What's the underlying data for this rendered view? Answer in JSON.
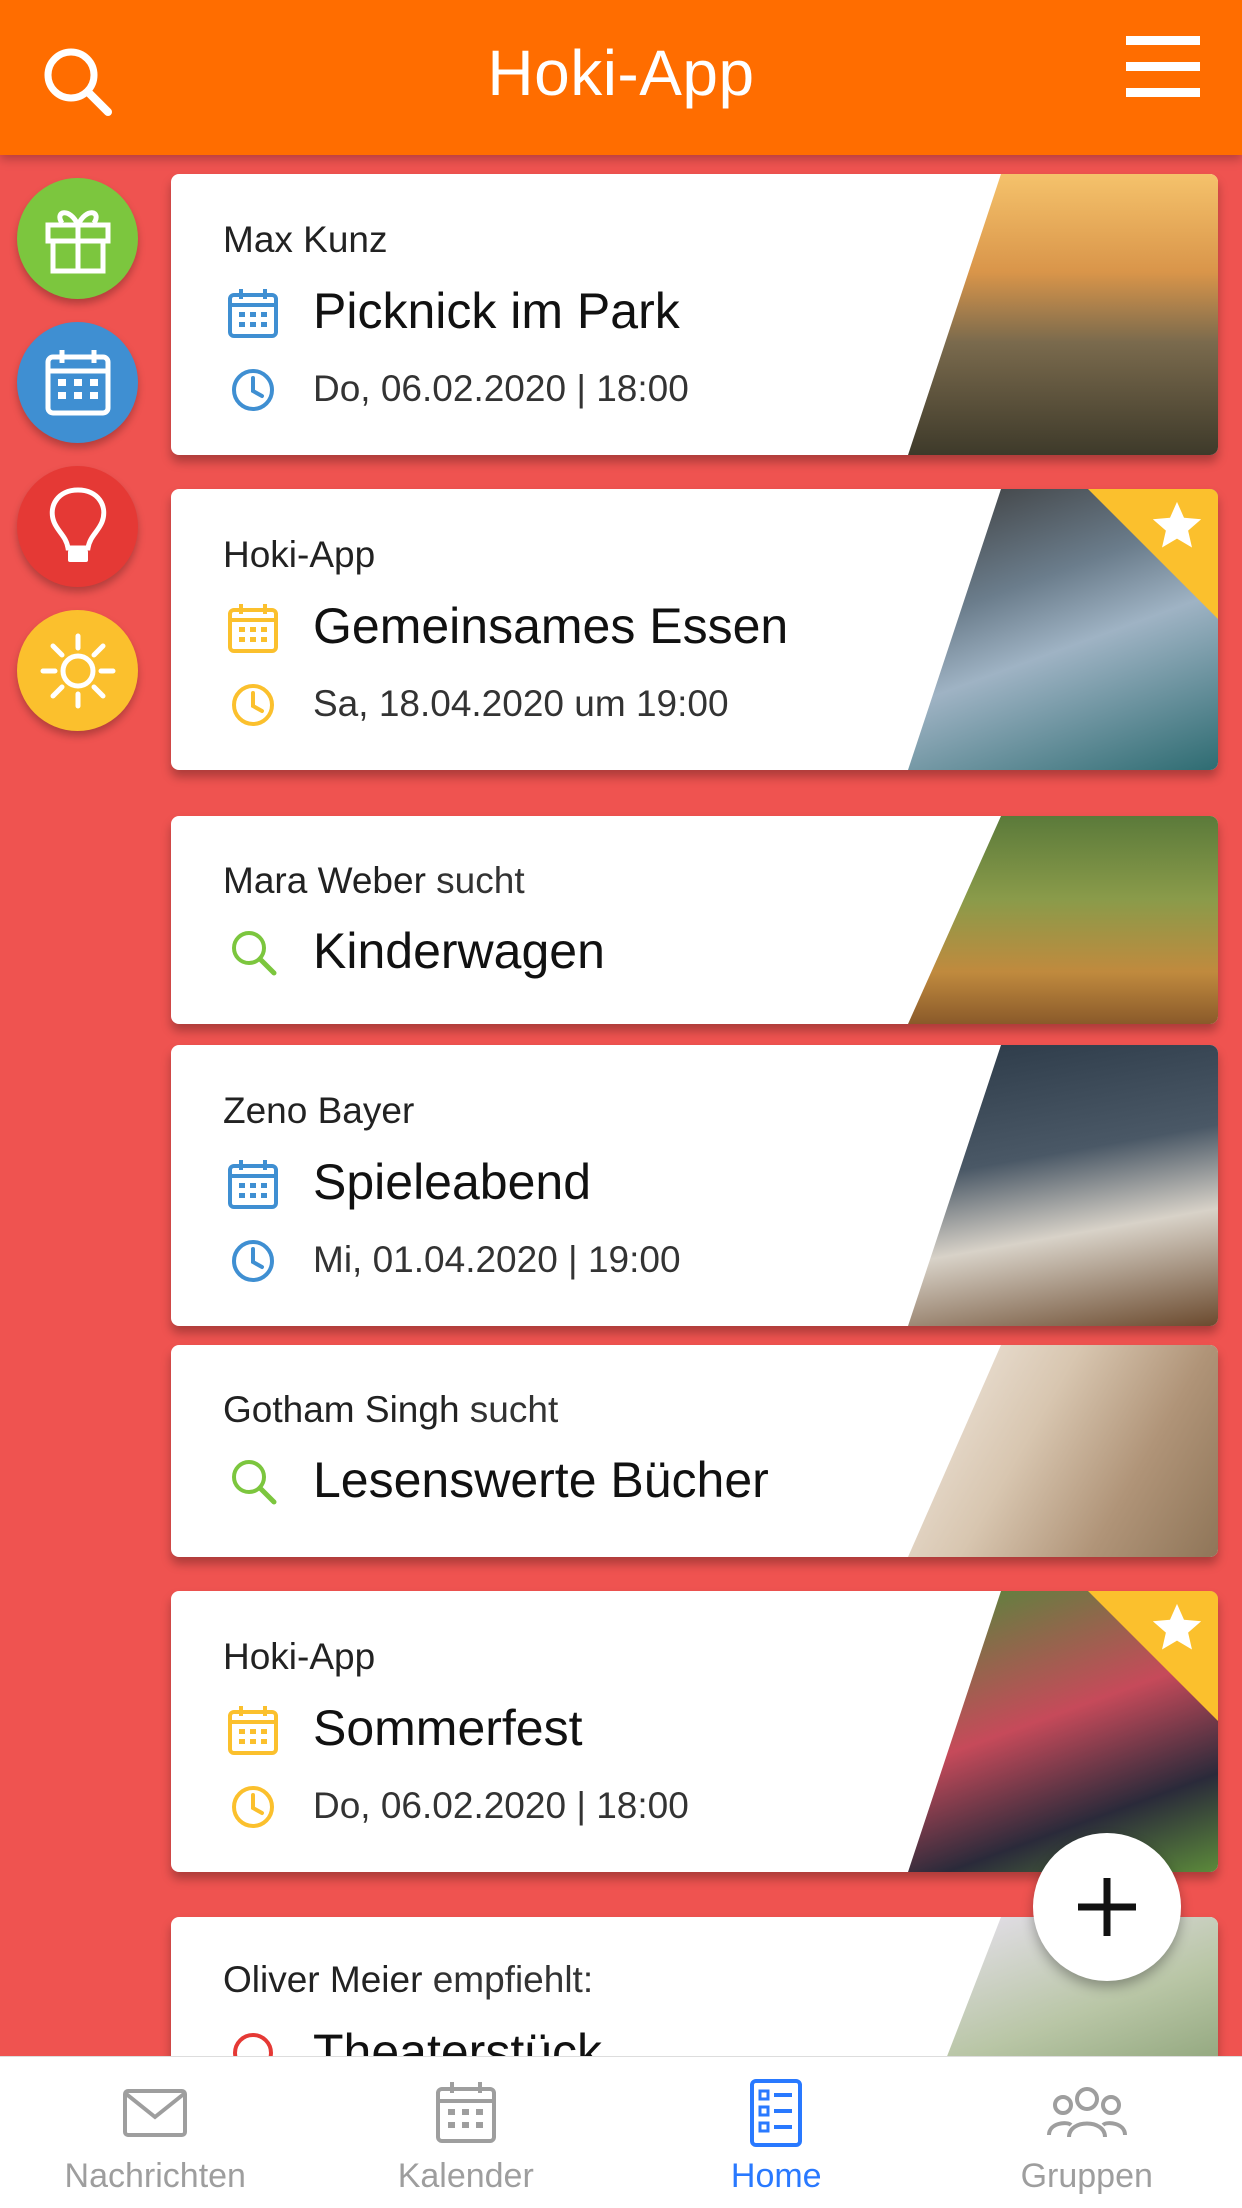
{
  "header": {
    "title": "Hoki-App",
    "search_icon": "search-icon",
    "menu_icon": "menu-icon"
  },
  "rail": [
    {
      "name": "gift",
      "icon": "gift-icon",
      "color": "#7cc63e"
    },
    {
      "name": "calendar",
      "icon": "calendar-icon",
      "color": "#3f8fd2"
    },
    {
      "name": "idea",
      "icon": "lightbulb-icon",
      "color": "#e53935"
    },
    {
      "name": "settings",
      "icon": "sun-icon",
      "color": "#fbc02d"
    }
  ],
  "feed": [
    {
      "author": "Max Kunz",
      "verb": "",
      "title": "Picknick im Park",
      "when": "Do, 06.02.2020 | 18:00",
      "type": "event",
      "accent": "#3f8fd2",
      "starred": false
    },
    {
      "author": "Hoki-App",
      "verb": "",
      "title": "Gemeinsames Essen",
      "when": "Sa, 18.04.2020 um 19:00",
      "type": "event",
      "accent": "#fbc02d",
      "starred": true
    },
    {
      "author": "Mara Weber",
      "verb": " sucht",
      "title": "Kinderwagen",
      "when": "",
      "type": "search",
      "accent": "#7cc63e",
      "starred": false
    },
    {
      "author": "Zeno Bayer",
      "verb": "",
      "title": "Spieleabend",
      "when": "Mi, 01.04.2020 | 19:00",
      "type": "event",
      "accent": "#3f8fd2",
      "starred": false
    },
    {
      "author": "Gotham Singh",
      "verb": " sucht",
      "title": "Lesenswerte Bücher",
      "when": "",
      "type": "search",
      "accent": "#7cc63e",
      "starred": false
    },
    {
      "author": "Hoki-App",
      "verb": "",
      "title": "Sommerfest",
      "when": "Do, 06.02.2020 | 18:00",
      "type": "event",
      "accent": "#fbc02d",
      "starred": true
    },
    {
      "author": "Oliver Meier",
      "verb": " empfiehlt:",
      "title": "Theaterstück",
      "when": "",
      "type": "recommend",
      "accent": "#e53935",
      "starred": false
    }
  ],
  "fab": {
    "icon": "plus-icon"
  },
  "nav": [
    {
      "label": "Nachrichten",
      "icon": "mail-icon",
      "active": false
    },
    {
      "label": "Kalender",
      "icon": "calendar-icon",
      "active": false
    },
    {
      "label": "Home",
      "icon": "list-icon",
      "active": true
    },
    {
      "label": "Gruppen",
      "icon": "group-icon",
      "active": false
    }
  ],
  "colors": {
    "header": "#ff6d00",
    "background": "#ef5350",
    "active_nav": "#2979ff",
    "inactive_nav": "#9e9e9e"
  }
}
